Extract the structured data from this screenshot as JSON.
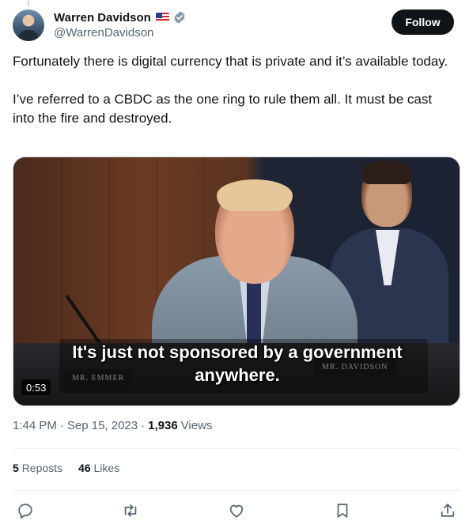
{
  "author": {
    "display_name": "Warren Davidson",
    "handle": "@WarrenDavidson",
    "flag_icon": "us-flag-icon",
    "verified_icon": "verified-badge-icon"
  },
  "follow_label": "Follow",
  "tweet": {
    "paragraphs": [
      "Fortunately there is digital currency that is private and it’s available today.",
      "I’ve referred to a CBDC as the one ring to rule them all. It must be cast into the fire and destroyed."
    ]
  },
  "media": {
    "caption_line1": "It's just not sponsored by a government",
    "caption_line2": "anywhere.",
    "nameplate_left": "MR. EMMER",
    "nameplate_right": "MR. DAVIDSON",
    "duration": "0:53"
  },
  "meta": {
    "time": "1:44 PM",
    "separator": "·",
    "date": "Sep 15, 2023",
    "views_count": "1,936",
    "views_label": "Views"
  },
  "stats": {
    "reposts_count": "5",
    "reposts_label": "Reposts",
    "likes_count": "46",
    "likes_label": "Likes"
  },
  "actions": [
    "reply-icon",
    "repost-icon",
    "like-icon",
    "bookmark-icon",
    "share-icon"
  ],
  "colors": {
    "text_primary": "#0f1419",
    "text_secondary": "#536471",
    "divider": "#eff3f4",
    "follow_bg": "#0f1419",
    "verified_blue": "#829aab"
  }
}
